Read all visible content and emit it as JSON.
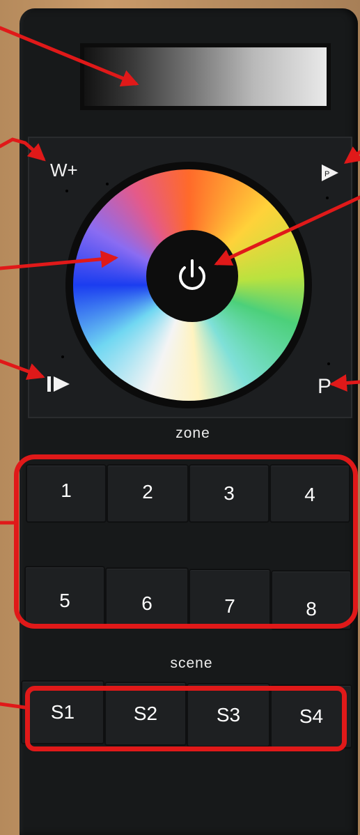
{
  "remote": {
    "top_buttons": {
      "w_plus": "W+",
      "p": "P"
    },
    "power_icon": "power-icon",
    "play_icons": [
      "play-next-icon",
      "play-p-icon"
    ],
    "zone": {
      "label": "zone",
      "buttons": [
        "1",
        "2",
        "3",
        "4",
        "5",
        "6",
        "7",
        "8"
      ]
    },
    "scene": {
      "label": "scene",
      "buttons": [
        "S1",
        "S2",
        "S3",
        "S4"
      ]
    }
  },
  "annotation_color": "#e01919"
}
